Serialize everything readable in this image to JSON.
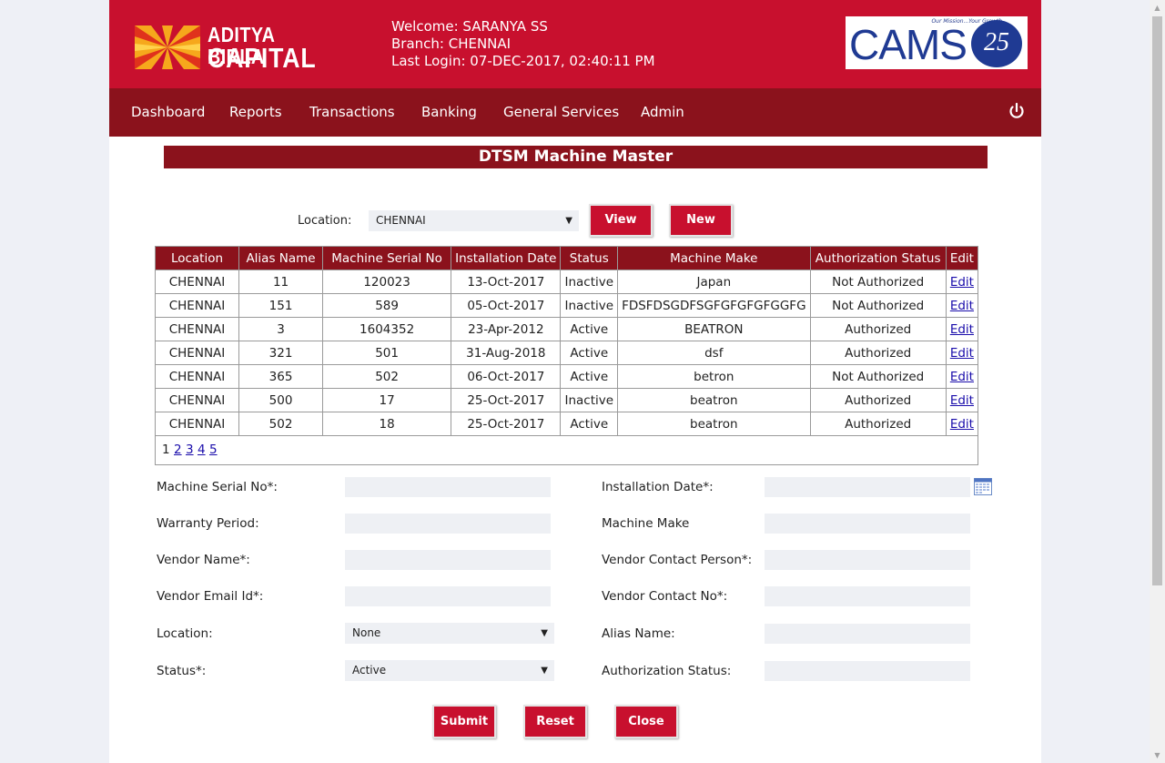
{
  "header": {
    "brand_line1": "ADITYA BIRLA",
    "brand_line2": "CAPITAL",
    "welcome": "Welcome: SARANYA SS",
    "branch": "Branch: CHENNAI",
    "last_login": "Last Login: 07-DEC-2017, 02:40:11 PM",
    "cams_tagline": "Our Mission...Your Growth",
    "cams_word": "CAMS",
    "cams_number": "25"
  },
  "nav": {
    "items": [
      "Dashboard",
      "Reports",
      "Transactions",
      "Banking",
      "General Services",
      "Admin"
    ],
    "power_icon": "power-icon"
  },
  "page_title": "DTSM Machine Master",
  "filter": {
    "location_label": "Location:",
    "location_value": "CHENNAI",
    "view_label": "View",
    "new_label": "New"
  },
  "table": {
    "columns": [
      "Location",
      "Alias Name",
      "Machine Serial No",
      "Installation Date",
      "Status",
      "Machine Make",
      "Authorization Status",
      "Edit"
    ],
    "rows": [
      [
        "CHENNAI",
        "11",
        "120023",
        "13-Oct-2017",
        "Inactive",
        "Japan",
        "Not Authorized",
        "Edit"
      ],
      [
        "CHENNAI",
        "151",
        "589",
        "05-Oct-2017",
        "Inactive",
        "FDSFDSGDFSGFGFGFGFGGFG",
        "Not Authorized",
        "Edit"
      ],
      [
        "CHENNAI",
        "3",
        "1604352",
        "23-Apr-2012",
        "Active",
        "BEATRON",
        "Authorized",
        "Edit"
      ],
      [
        "CHENNAI",
        "321",
        "501",
        "31-Aug-2018",
        "Active",
        "dsf",
        "Authorized",
        "Edit"
      ],
      [
        "CHENNAI",
        "365",
        "502",
        "06-Oct-2017",
        "Active",
        "betron",
        "Not Authorized",
        "Edit"
      ],
      [
        "CHENNAI",
        "500",
        "17",
        "25-Oct-2017",
        "Inactive",
        "beatron",
        "Authorized",
        "Edit"
      ],
      [
        "CHENNAI",
        "502",
        "18",
        "25-Oct-2017",
        "Active",
        "beatron",
        "Authorized",
        "Edit"
      ]
    ],
    "pages": [
      "1",
      "2",
      "3",
      "4",
      "5"
    ],
    "current_page": "1"
  },
  "form": {
    "machine_serial_label": "Machine Serial No*:",
    "installation_date_label": "Installation Date*:",
    "warranty_label": "Warranty Period:",
    "machine_make_label": "Machine Make",
    "vendor_name_label": "Vendor Name*:",
    "vendor_contact_person_label": "Vendor Contact Person*:",
    "vendor_email_label": "Vendor Email Id*:",
    "vendor_contact_no_label": "Vendor Contact No*:",
    "location_label": "Location:",
    "location_value": "None",
    "alias_label": "Alias Name:",
    "status_label": "Status*:",
    "status_value": "Active",
    "auth_status_label": "Authorization Status:",
    "calendar_icon": "calendar-icon"
  },
  "actions": {
    "submit_label": "Submit",
    "reset_label": "Reset",
    "close_label": "Close"
  },
  "colors": {
    "brand_red": "#c8102e",
    "nav_maroon": "#8b121c",
    "page_bg": "#eef0f6"
  }
}
